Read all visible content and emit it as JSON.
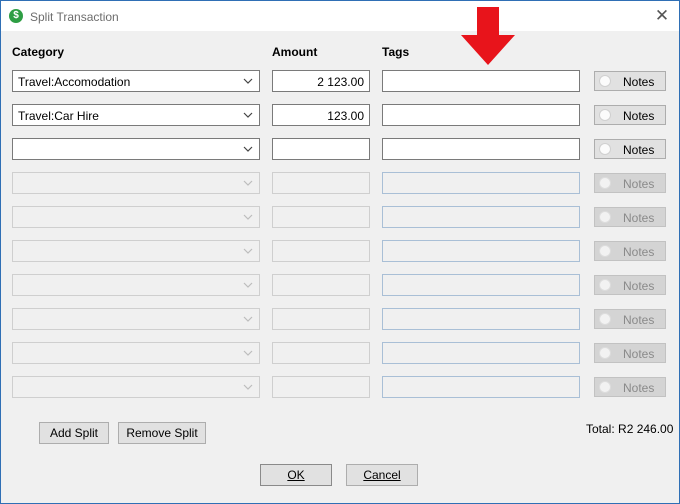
{
  "window": {
    "title": "Split Transaction",
    "close_glyph": "✕",
    "app_icon_glyph": "$"
  },
  "headers": {
    "category": "Category",
    "amount": "Amount",
    "tags": "Tags"
  },
  "rows": [
    {
      "category": "Travel:Accomodation",
      "amount": "2 123.00",
      "tags": "",
      "enabled": true
    },
    {
      "category": "Travel:Car Hire",
      "amount": "123.00",
      "tags": "",
      "enabled": true
    },
    {
      "category": "",
      "amount": "",
      "tags": "",
      "enabled": true
    },
    {
      "category": "",
      "amount": "",
      "tags": "",
      "enabled": false
    },
    {
      "category": "",
      "amount": "",
      "tags": "",
      "enabled": false
    },
    {
      "category": "",
      "amount": "",
      "tags": "",
      "enabled": false
    },
    {
      "category": "",
      "amount": "",
      "tags": "",
      "enabled": false
    },
    {
      "category": "",
      "amount": "",
      "tags": "",
      "enabled": false
    },
    {
      "category": "",
      "amount": "",
      "tags": "",
      "enabled": false
    },
    {
      "category": "",
      "amount": "",
      "tags": "",
      "enabled": false
    }
  ],
  "notes_label": "Notes",
  "buttons": {
    "add_split": "Add Split",
    "remove_split": "Remove Split",
    "ok": "OK",
    "cancel": "Cancel"
  },
  "total": {
    "label": "Total:",
    "value": "R2 246.00"
  },
  "colors": {
    "arrow": "#e8141b",
    "window_border": "#2f6fb5",
    "app_icon": "#2e9e44"
  }
}
